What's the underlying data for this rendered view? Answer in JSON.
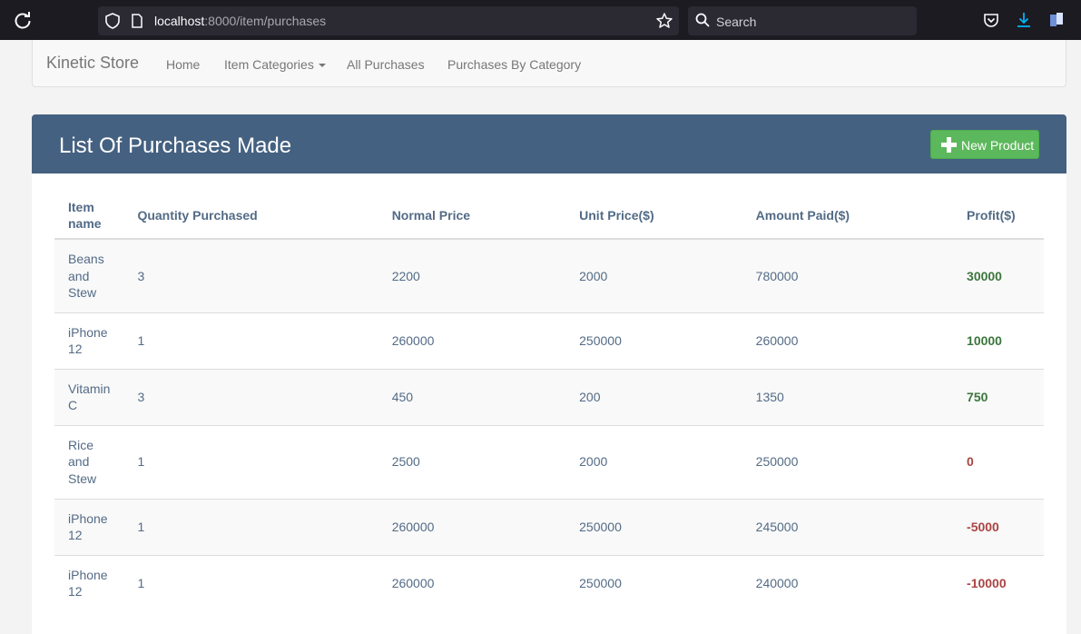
{
  "browser": {
    "url_host": "localhost",
    "url_path": ":8000/item/purchases",
    "search_placeholder": "Search"
  },
  "navbar": {
    "brand": "Kinetic Store",
    "links": [
      "Home",
      "Item Categories",
      "All Purchases",
      "Purchases By Category"
    ]
  },
  "panel": {
    "title": "List Of Purchases Made",
    "new_button": "New Product"
  },
  "table": {
    "headers": [
      "Item name",
      "Quantity Purchased",
      "Normal Price",
      "Unit Price($)",
      "Amount Paid($)",
      "Profit($)"
    ],
    "rows": [
      {
        "item": "Beans and Stew",
        "qty": "3",
        "normal": "2200",
        "unit": "2000",
        "paid": "780000",
        "profit": "30000"
      },
      {
        "item": "iPhone 12",
        "qty": "1",
        "normal": "260000",
        "unit": "250000",
        "paid": "260000",
        "profit": "10000"
      },
      {
        "item": "Vitamin C",
        "qty": "3",
        "normal": "450",
        "unit": "200",
        "paid": "1350",
        "profit": "750"
      },
      {
        "item": "Rice and Stew",
        "qty": "1",
        "normal": "2500",
        "unit": "2000",
        "paid": "250000",
        "profit": "0"
      },
      {
        "item": "iPhone 12",
        "qty": "1",
        "normal": "260000",
        "unit": "250000",
        "paid": "245000",
        "profit": "-5000"
      },
      {
        "item": "iPhone 12",
        "qty": "1",
        "normal": "260000",
        "unit": "250000",
        "paid": "240000",
        "profit": "-10000"
      }
    ]
  },
  "colors": {
    "panel_heading": "#456181",
    "button_green": "#5cb85c",
    "profit_positive": "#3c763d",
    "profit_negative": "#a94442"
  },
  "icons": [
    "reload-icon",
    "shield-icon",
    "page-icon",
    "bookmark-star-icon",
    "search-icon",
    "pocket-icon",
    "download-icon",
    "extension-icon",
    "plus-icon",
    "caret-down-icon"
  ]
}
